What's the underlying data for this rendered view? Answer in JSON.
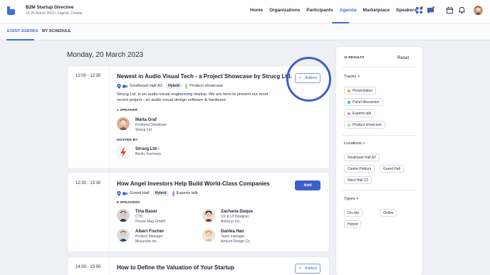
{
  "header": {
    "event_name": "B2M Startup Directive",
    "event_sub": "10-25 March 2023 | Zagreb, Croatia",
    "nav": [
      "Home",
      "Organizations",
      "Participants",
      "Agenda",
      "Marketplace",
      "Speakers"
    ],
    "active_nav": "Agenda"
  },
  "tabs": [
    "EVENT AGENDA",
    "MY SCHEDULE"
  ],
  "date_heading": "Monday, 20 March 2023",
  "sessions": [
    {
      "time": "12:00 - 12:30",
      "title": "Newest in Audio Visual Tech - a Project Showcase by Strucg Ltd.",
      "location": "Southeast Hall A2",
      "format": "Hybrid",
      "track": "Product showcase",
      "track_color": "#a6e07a",
      "description_1": "Strucg Ltd. is an audio-visual engineering startup. We are here to present our most",
      "description_2": "recent project - an audio-visual design software & hardware.",
      "speakers_label": "1 SPEAKER",
      "speaker": {
        "name": "Marta Graf",
        "role": "Frontend Developer",
        "company": "Strucg Ltd"
      },
      "hosted_label": "HOSTED BY",
      "host": {
        "name": "Strucg Ltd",
        "location": "Berlin, Germany"
      },
      "button": "Added"
    },
    {
      "time": "12:30 - 13:30",
      "title": "How Angel Investors Help Build World-Class Companies",
      "location": "Grand Hall",
      "format": "Hybrid",
      "track": "Experts talk",
      "track_color": "#c88ee0",
      "speakers_label": "6 SPEAKERS",
      "speakers": [
        {
          "name": "Tina Bauer",
          "role": "CTO",
          "company": "Pexels Mag GmbH"
        },
        {
          "name": "Zacharia Duque",
          "role": "UX & UI Designer",
          "company": "Antrunci Inc."
        },
        {
          "name": "Albert Fischer",
          "role": "Product Manager",
          "company": "Moyurvee Inc."
        },
        {
          "name": "Danika Han",
          "role": "Team manager",
          "company": "Armunt Design Co"
        }
      ],
      "button": "Add"
    },
    {
      "time": "14:00 - 15:00",
      "title": "How to Define the Valuation of Your Startup",
      "button": "Added"
    }
  ],
  "filters": {
    "results": "11 RESULTS",
    "reset": "Reset",
    "tracks_label": "Tracks",
    "tracks": [
      {
        "label": "Presentation",
        "color": "#f0a23c"
      },
      {
        "label": "Panel discussion",
        "color": "#3fb0e0"
      },
      {
        "label": "Experts talk",
        "color": "#c88ee0"
      },
      {
        "label": "Product showcase",
        "color": "#a6e07a"
      }
    ],
    "locations_label": "Locations",
    "locations": [
      "Southeast Hall A2",
      "Centre Podium",
      "Grand Hall",
      "West Hall C3"
    ],
    "types_label": "Types",
    "types": [
      "On-site",
      "Online",
      "Hybrid"
    ]
  }
}
